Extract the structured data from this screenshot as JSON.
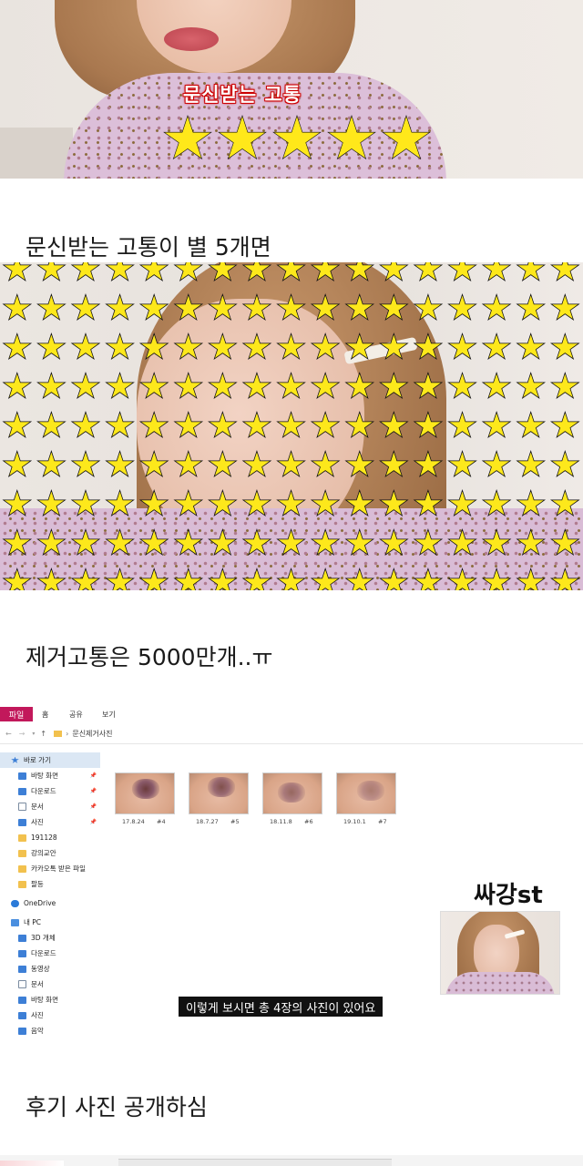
{
  "panel1": {
    "caption": "문신받는 고통",
    "star_rating": {
      "count": 5,
      "max": 5,
      "color": "#ffe81a"
    }
  },
  "text_lines": {
    "line1": "문신받는 고통이 별 5개면",
    "line2": "제거고통은 5000만개..ㅠ",
    "line3": "후기 사진 공개하심"
  },
  "panel2": {
    "star_grid": {
      "rows": 9,
      "cols": 17,
      "color": "#fde81b"
    }
  },
  "explorer": {
    "tabs": [
      "파일",
      "홈",
      "공유",
      "보기"
    ],
    "path": [
      "문신제거사진"
    ],
    "nav_items": [
      {
        "label": "바로 가기",
        "icon": "star-icon",
        "selected": true
      },
      {
        "label": "바탕 화면",
        "icon": "desktop-icon",
        "pinned": true
      },
      {
        "label": "다운로드",
        "icon": "download-icon",
        "pinned": true
      },
      {
        "label": "문서",
        "icon": "document-icon",
        "pinned": true
      },
      {
        "label": "사진",
        "icon": "pictures-icon",
        "pinned": true
      },
      {
        "label": "191128",
        "icon": "folder-icon"
      },
      {
        "label": "강의교안",
        "icon": "folder-icon"
      },
      {
        "label": "카카오톡 받은 파일",
        "icon": "folder-icon"
      },
      {
        "label": "팔등",
        "icon": "folder-icon"
      },
      {
        "label": "OneDrive",
        "icon": "cloud-icon"
      },
      {
        "label": "내 PC",
        "icon": "pc-icon"
      },
      {
        "label": "3D 개체",
        "icon": "3d-objects-icon"
      },
      {
        "label": "다운로드",
        "icon": "download-icon"
      },
      {
        "label": "동영상",
        "icon": "video-icon"
      },
      {
        "label": "문서",
        "icon": "document-icon"
      },
      {
        "label": "바탕 화면",
        "icon": "desktop-icon"
      },
      {
        "label": "사진",
        "icon": "pictures-icon"
      },
      {
        "label": "음악",
        "icon": "music-icon"
      }
    ],
    "files": [
      {
        "date": "17.8.24",
        "num": "#4"
      },
      {
        "date": "18.7.27",
        "num": "#5"
      },
      {
        "date": "18.11.8",
        "num": "#6"
      },
      {
        "date": "19.10.1",
        "num": "#7"
      }
    ],
    "brand": "싸강st",
    "subtitle": "이렇게 보시면 총 4장의 사진이 있어요",
    "accent": "#c2185b"
  }
}
